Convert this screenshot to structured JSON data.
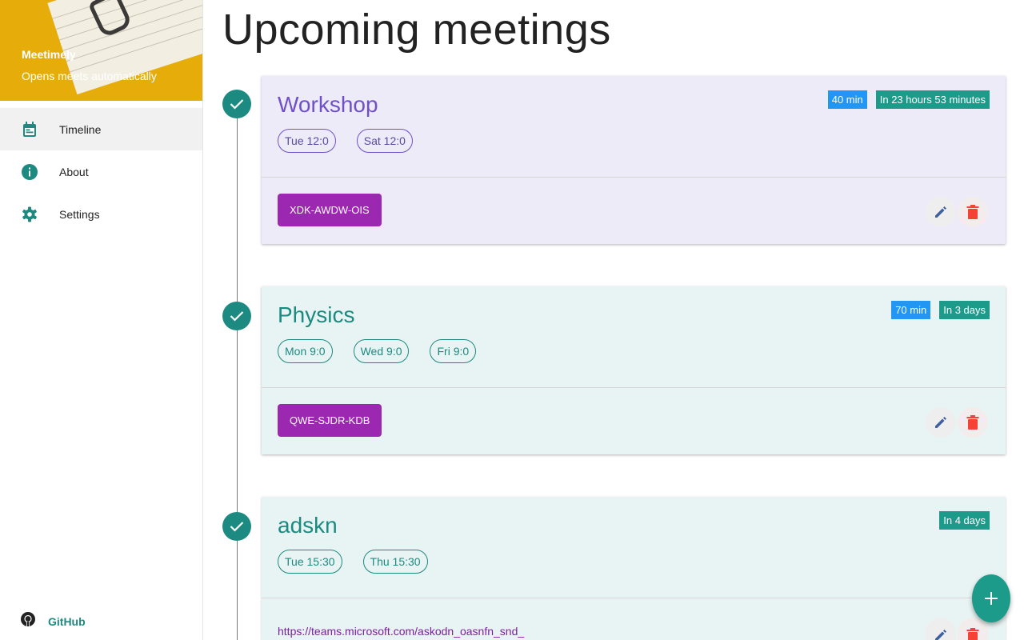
{
  "app": {
    "name": "Meetimely",
    "tagline": "Opens meets automatically"
  },
  "nav": {
    "items": [
      {
        "label": "Timeline",
        "icon": "calendar-icon",
        "active": true
      },
      {
        "label": "About",
        "icon": "info-icon",
        "active": false
      },
      {
        "label": "Settings",
        "icon": "gear-icon",
        "active": false
      }
    ],
    "github": "GitHub"
  },
  "page": {
    "title": "Upcoming meetings"
  },
  "meetings": [
    {
      "title": "Workshop",
      "theme": {
        "bg": "#eeebf9",
        "accent": "#7050c8"
      },
      "schedule": [
        "Tue 12:0",
        "Sat 12:0"
      ],
      "duration": "40 min",
      "countdown": "In 23 hours 53 minutes",
      "code": "XDK-AWDW-OIS"
    },
    {
      "title": "Physics",
      "theme": {
        "bg": "#e8f4f3",
        "accent": "#1c8a80"
      },
      "schedule": [
        "Mon 9:0",
        "Wed 9:0",
        "Fri 9:0"
      ],
      "duration": "70 min",
      "countdown": "In 3 days",
      "code": "QWE-SJDR-KDB"
    },
    {
      "title": "adskn",
      "theme": {
        "bg": "#e8f4f3",
        "accent": "#1c8a80"
      },
      "schedule": [
        "Tue 15:30",
        "Thu 15:30"
      ],
      "countdown": "In 4 days",
      "link": "https://teams.microsoft.com/askodn_oasnfn_snd_"
    }
  ],
  "colors": {
    "brand": "#e6ad0a",
    "teal": "#1c8a80",
    "purple": "#9c27b0",
    "blue": "#2196f3",
    "danger": "#f44336",
    "edit": "#3f5f9e"
  },
  "fab": {
    "icon": "plus-icon"
  }
}
